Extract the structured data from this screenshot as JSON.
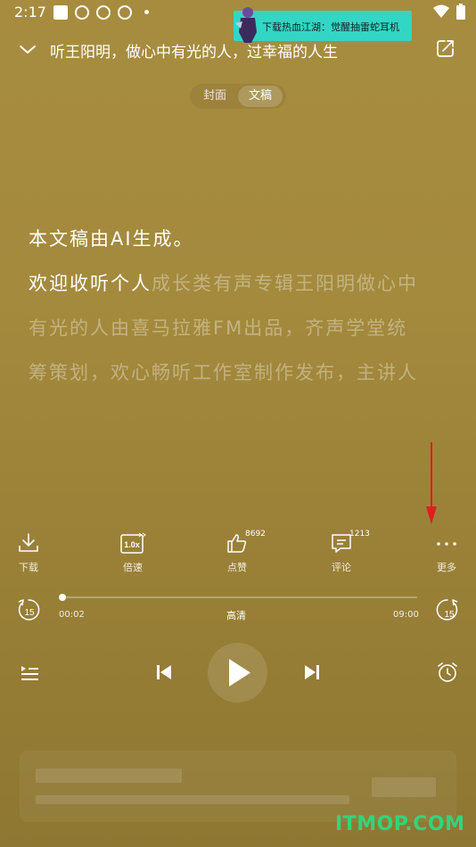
{
  "status_bar": {
    "time": "2:17"
  },
  "ad": {
    "text": "下载热血江湖：觉醒抽雷蛇耳机"
  },
  "header": {
    "title": "听王阳明，做心中有光的人，过幸福的人生"
  },
  "toggle": {
    "cover": "封面",
    "script": "文稿"
  },
  "transcript": {
    "line1": "本文稿由AI生成。",
    "line2_read": "欢迎收听个人",
    "line2_rest": "成长类有声专辑王阳明做心中",
    "line3": "有光的人由喜马拉雅FM出品，齐声学堂统",
    "line4": "筹策划，欢心畅听工作室制作发布，主讲人"
  },
  "actions": {
    "download": "下载",
    "speed": "倍速",
    "speed_badge": "1.0x",
    "like": "点赞",
    "like_count": "8692",
    "comment": "评论",
    "comment_count": "1213",
    "more": "更多"
  },
  "player": {
    "elapsed": "00:02",
    "total": "09:00",
    "quality": "高清",
    "rewind_seconds": "15",
    "forward_seconds": "15",
    "progress": 0.004
  },
  "watermark": "ITMOP.COM",
  "colors": {
    "background": "#a48a3d",
    "annotation_arrow": "#e01e1e",
    "watermark": "#2fd67a",
    "ad_bg": "#33d6c4"
  }
}
